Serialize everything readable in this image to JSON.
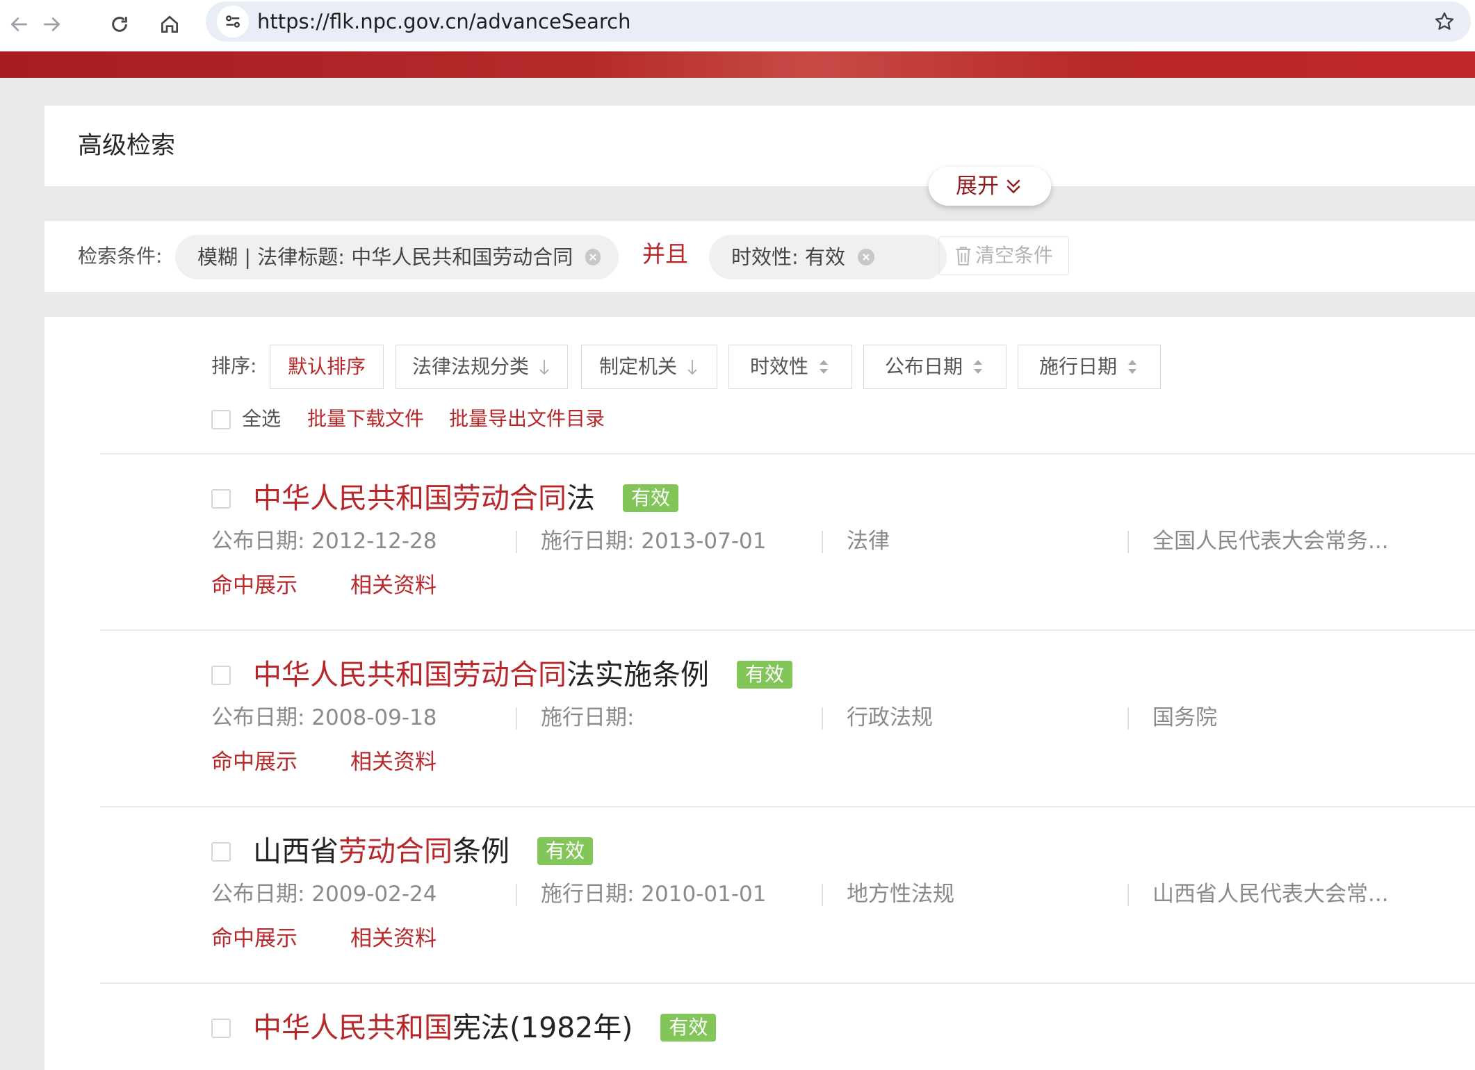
{
  "browser": {
    "url": "https://flk.npc.gov.cn/advanceSearch"
  },
  "header": {
    "title": "高级检索",
    "expand_label": "展开"
  },
  "criteria": {
    "label": "检索条件:",
    "chip1": "模糊 | 法律标题: 中华人民共和国劳动合同",
    "and_label": "并且",
    "chip2": "时效性: 有效",
    "clear_label": "清空条件"
  },
  "toolbar": {
    "sort_label": "排序:",
    "sort_options": [
      "默认排序",
      "法律法规分类",
      "制定机关",
      "时效性",
      "公布日期",
      "施行日期"
    ],
    "select_all_label": "全选",
    "batch_download": "批量下载文件",
    "batch_export": "批量导出文件目录"
  },
  "results": [
    {
      "title_hl1": "中华人民共和国劳动合同",
      "title_rest": "法",
      "badge": "有效",
      "publish": "公布日期: 2012-12-28",
      "effective": "施行日期: 2013-07-01",
      "type": "法律",
      "organ": "全国人民代表大会常务...",
      "link_hit": "命中展示",
      "link_related": "相关资料"
    },
    {
      "title_hl1": "中华人民共和国劳动合同",
      "title_rest": "法实施条例",
      "badge": "有效",
      "publish": "公布日期: 2008-09-18",
      "effective": "施行日期:",
      "type": "行政法规",
      "organ": "国务院",
      "link_hit": "命中展示",
      "link_related": "相关资料"
    },
    {
      "title_pre": "山西省",
      "title_hl1": "劳动合同",
      "title_rest": "条例",
      "badge": "有效",
      "publish": "公布日期: 2009-02-24",
      "effective": "施行日期: 2010-01-01",
      "type": "地方性法规",
      "organ": "山西省人民代表大会常...",
      "link_hit": "命中展示",
      "link_related": "相关资料"
    },
    {
      "title_hl1": "中华人民共和国",
      "title_rest": "宪法(1982年)",
      "badge": "有效"
    }
  ],
  "colors": {
    "brand_red": "#b8282b",
    "badge_green": "#82c65a"
  },
  "icons": [
    "back-arrow-icon",
    "forward-arrow-icon",
    "reload-icon",
    "home-icon",
    "site-settings-icon",
    "star-icon",
    "chevron-down-double-icon",
    "close-icon",
    "trash-icon",
    "arrow-down-icon",
    "sort-updown-icon"
  ]
}
